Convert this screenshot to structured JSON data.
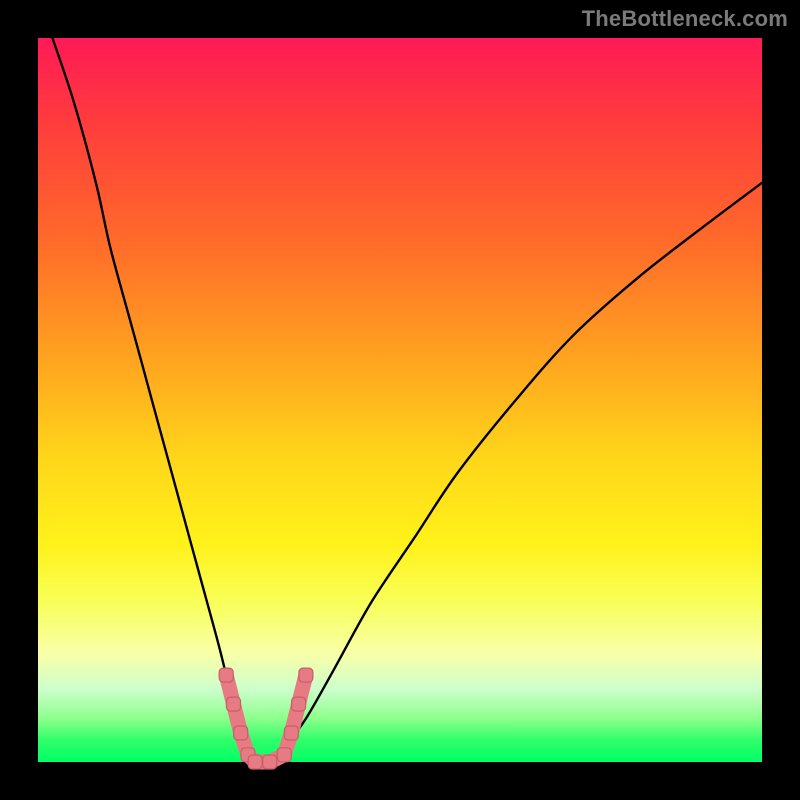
{
  "watermark": "TheBottleneck.com",
  "colors": {
    "background": "#000000",
    "gradient_top": "#ff1a56",
    "gradient_mid": "#fff21a",
    "gradient_bottom": "#00ff66",
    "curve": "#000000",
    "marker": "#e77b84"
  },
  "chart_data": {
    "type": "line",
    "title": "",
    "xlabel": "",
    "ylabel": "",
    "xlim": [
      0,
      100
    ],
    "ylim": [
      0,
      100
    ],
    "grid": false,
    "legend": false,
    "note": "Axes unlabeled; values estimated from pixel positions. Single V-shaped bottleneck curve with minimum near x≈30 and highlighted marker cluster at the trough. y is approximate percentage bottleneck (0=green/good, 100=red/bad).",
    "series": [
      {
        "name": "bottleneck-curve",
        "x": [
          2,
          5,
          8,
          10,
          13,
          16,
          19,
          22,
          25,
          27,
          29,
          30,
          32,
          34,
          37,
          41,
          46,
          52,
          58,
          66,
          74,
          83,
          92,
          100
        ],
        "y": [
          100,
          91,
          80,
          71,
          60,
          49,
          38,
          27,
          16,
          8,
          2,
          0,
          0,
          2,
          6,
          13,
          22,
          31,
          40,
          50,
          59,
          67,
          74,
          80
        ]
      }
    ],
    "markers": {
      "name": "highlighted-range",
      "points": [
        {
          "x": 26,
          "y": 12
        },
        {
          "x": 27,
          "y": 8
        },
        {
          "x": 28,
          "y": 4
        },
        {
          "x": 29,
          "y": 1
        },
        {
          "x": 30,
          "y": 0
        },
        {
          "x": 32,
          "y": 0
        },
        {
          "x": 34,
          "y": 1
        },
        {
          "x": 35,
          "y": 4
        },
        {
          "x": 36,
          "y": 8
        },
        {
          "x": 37,
          "y": 12
        }
      ]
    }
  }
}
